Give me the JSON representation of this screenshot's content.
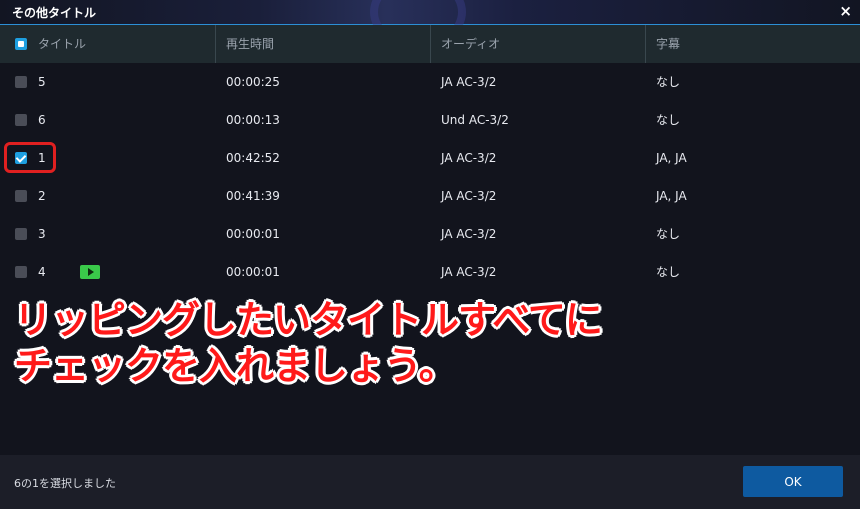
{
  "dialog": {
    "title": "その他タイトル",
    "close_glyph": "×"
  },
  "columns": {
    "title": "タイトル",
    "duration": "再生時間",
    "audio": "オーディオ",
    "subtitle": "字幕"
  },
  "rows": [
    {
      "id": "5",
      "duration": "00:00:25",
      "audio": "JA AC-3/2",
      "subtitle": "なし",
      "checked": false,
      "playing": false
    },
    {
      "id": "6",
      "duration": "00:00:13",
      "audio": "Und AC-3/2",
      "subtitle": "なし",
      "checked": false,
      "playing": false
    },
    {
      "id": "1",
      "duration": "00:42:52",
      "audio": "JA AC-3/2",
      "subtitle": "JA, JA",
      "checked": true,
      "playing": false
    },
    {
      "id": "2",
      "duration": "00:41:39",
      "audio": "JA AC-3/2",
      "subtitle": "JA, JA",
      "checked": false,
      "playing": false
    },
    {
      "id": "3",
      "duration": "00:00:01",
      "audio": "JA AC-3/2",
      "subtitle": "なし",
      "checked": false,
      "playing": false
    },
    {
      "id": "4",
      "duration": "00:00:01",
      "audio": "JA AC-3/2",
      "subtitle": "なし",
      "checked": false,
      "playing": true
    }
  ],
  "annotation": {
    "line1": "リッピングしたいタイトルすべてに",
    "line2": "チェックを入れましょう。"
  },
  "footer": {
    "status": "6の1を選択しました",
    "ok_label": "OK"
  },
  "colors": {
    "accent": "#1e9fe0",
    "highlight": "#e02020",
    "play": "#3ac94a",
    "ok_button": "#0e5aa0"
  }
}
